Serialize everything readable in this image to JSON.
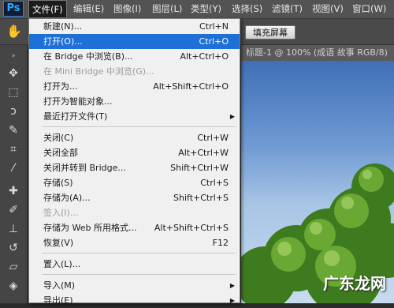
{
  "app": {
    "logo_text": "Ps"
  },
  "menubar": {
    "items": [
      {
        "label": "文件(F)",
        "active": true
      },
      {
        "label": "编辑(E)"
      },
      {
        "label": "图像(I)"
      },
      {
        "label": "图层(L)"
      },
      {
        "label": "类型(Y)"
      },
      {
        "label": "选择(S)"
      },
      {
        "label": "滤镜(T)"
      },
      {
        "label": "视图(V)"
      },
      {
        "label": "窗口(W)"
      }
    ]
  },
  "options": {
    "fill_screen_button": "填充屏幕"
  },
  "document": {
    "tab_title": "标题-1 @ 100% (成语 故事 RGB/8)"
  },
  "watermark": {
    "text": "广东龙网"
  },
  "file_menu": {
    "items": [
      {
        "label": "新建(N)...",
        "shortcut": "Ctrl+N"
      },
      {
        "label": "打开(O)...",
        "shortcut": "Ctrl+O",
        "highlight": true
      },
      {
        "label": "在 Bridge 中浏览(B)...",
        "shortcut": "Alt+Ctrl+O"
      },
      {
        "label": "在 Mini Bridge 中浏览(G)...",
        "shortcut": "",
        "disabled": true
      },
      {
        "label": "打开为...",
        "shortcut": "Alt+Shift+Ctrl+O"
      },
      {
        "label": "打开为智能对象...",
        "shortcut": ""
      },
      {
        "label": "最近打开文件(T)",
        "shortcut": "",
        "submenu": true
      },
      {
        "label": "关闭(C)",
        "shortcut": "Ctrl+W"
      },
      {
        "label": "关闭全部",
        "shortcut": "Alt+Ctrl+W"
      },
      {
        "label": "关闭并转到 Bridge...",
        "shortcut": "Shift+Ctrl+W"
      },
      {
        "label": "存储(S)",
        "shortcut": "Ctrl+S"
      },
      {
        "label": "存储为(A)...",
        "shortcut": "Shift+Ctrl+S"
      },
      {
        "label": "签入(I)...",
        "shortcut": "",
        "disabled": true
      },
      {
        "label": "存储为 Web 所用格式...",
        "shortcut": "Alt+Shift+Ctrl+S"
      },
      {
        "label": "恢复(V)",
        "shortcut": "F12"
      },
      {
        "label": "置入(L)...",
        "shortcut": ""
      },
      {
        "label": "导入(M)",
        "shortcut": "",
        "submenu": true
      },
      {
        "label": "导出(E)",
        "shortcut": "",
        "submenu": true
      }
    ]
  },
  "tools": [
    "move-tool-icon",
    "marquee-tool-icon",
    "lasso-tool-icon",
    "quick-select-tool-icon",
    "crop-tool-icon",
    "eyedropper-tool-icon",
    "healing-brush-tool-icon",
    "brush-tool-icon",
    "clone-stamp-tool-icon",
    "history-brush-tool-icon",
    "eraser-tool-icon",
    "paint-bucket-tool-icon"
  ],
  "colors": {
    "highlight": "#1e6fd6",
    "menubar": "#535353",
    "menu_bg": "#f0f0f0"
  }
}
